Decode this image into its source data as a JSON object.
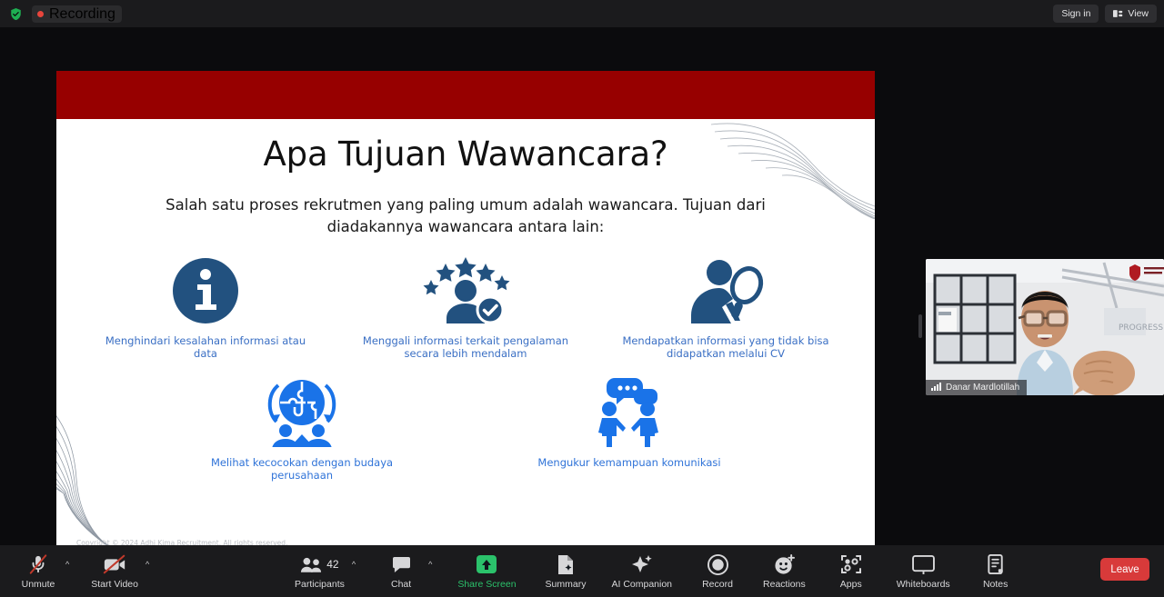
{
  "topbar": {
    "shield_icon": "shield-check-icon",
    "recording_label": "Recording",
    "sign_in_label": "Sign in",
    "view_label": "View",
    "view_icon": "layout-view-icon"
  },
  "slide": {
    "header_color": "#970000",
    "title": "Apa Tujuan Wawancara?",
    "subtitle": "Salah satu proses rekrutmen yang paling umum adalah wawancara. Tujuan dari diadakannya wawancara antara lain:",
    "items_row1": [
      {
        "icon": "info-circle-icon",
        "caption": "Menghindari kesalahan informasi atau data"
      },
      {
        "icon": "person-stars-check-icon",
        "caption": "Menggali informasi terkait pengalaman secara lebih mendalam"
      },
      {
        "icon": "person-magnifier-icon",
        "caption": "Mendapatkan informasi yang tidak bisa didapatkan melalui CV"
      }
    ],
    "items_row2": [
      {
        "icon": "puzzle-globe-people-icon",
        "caption": "Melihat kecocokan dengan budaya perusahaan"
      },
      {
        "icon": "two-people-chat-icon",
        "caption": "Mengukur kemampuan komunikasi"
      }
    ],
    "copyright": "Copyright © 2024 Adhi Kima Recruitment. All rights reserved."
  },
  "selfview": {
    "participant_name": "Danar Mardlotillah",
    "signal_icon": "signal-bars-icon"
  },
  "toolbar": {
    "left": [
      {
        "label": "Unmute",
        "icon": "microphone-muted-icon",
        "caret": true
      },
      {
        "label": "Start Video",
        "icon": "video-off-icon",
        "caret": true
      }
    ],
    "center": [
      {
        "label": "Participants",
        "icon": "participants-icon",
        "count": "42",
        "caret": true
      },
      {
        "label": "Chat",
        "icon": "chat-icon",
        "caret": true
      },
      {
        "label": "Share Screen",
        "icon": "share-screen-icon",
        "accent": true
      },
      {
        "label": "Summary",
        "icon": "summary-doc-icon"
      },
      {
        "label": "AI Companion",
        "icon": "ai-sparkle-icon"
      },
      {
        "label": "Record",
        "icon": "record-circle-icon"
      },
      {
        "label": "Reactions",
        "icon": "reactions-smiley-icon"
      },
      {
        "label": "Apps",
        "icon": "apps-icon"
      },
      {
        "label": "Whiteboards",
        "icon": "whiteboard-icon"
      },
      {
        "label": "Notes",
        "icon": "notes-icon"
      }
    ],
    "leave_label": "Leave",
    "accent_green": "#2bc26b",
    "leave_red": "#d83a3a"
  }
}
